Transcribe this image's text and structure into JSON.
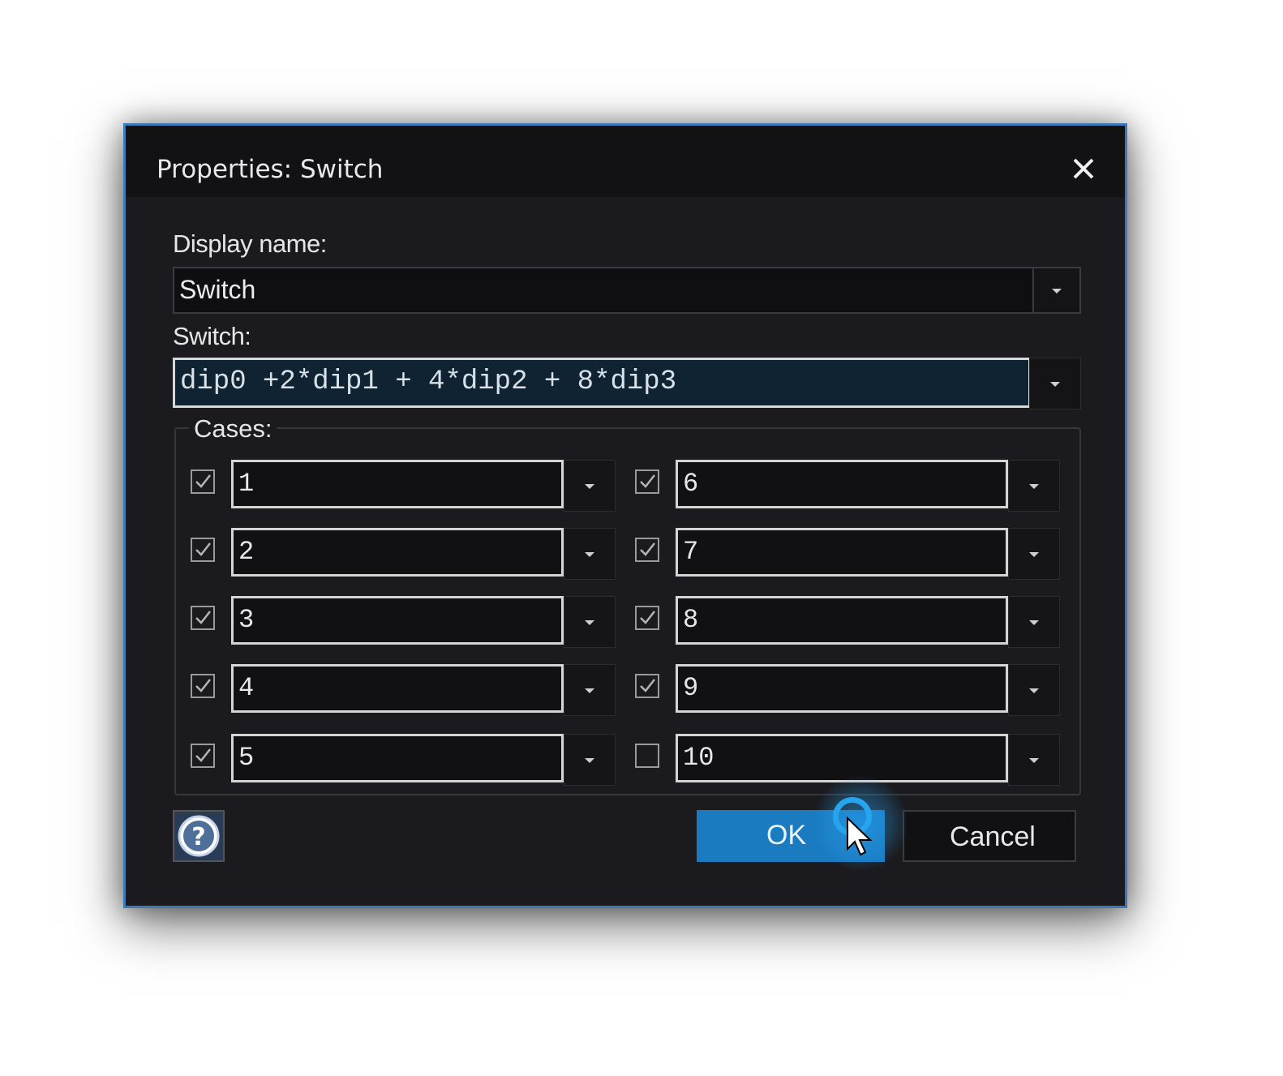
{
  "dialog": {
    "title": "Properties: Switch",
    "display_name_label": "Display name:",
    "display_name_value": "Switch",
    "switch_label": "Switch:",
    "switch_value": "dip0 +2*dip1 + 4*dip2 + 8*dip3",
    "cases_label": "Cases:",
    "cases": [
      {
        "value": "1",
        "checked": true
      },
      {
        "value": "2",
        "checked": true
      },
      {
        "value": "3",
        "checked": true
      },
      {
        "value": "4",
        "checked": true
      },
      {
        "value": "5",
        "checked": true
      },
      {
        "value": "6",
        "checked": true
      },
      {
        "value": "7",
        "checked": true
      },
      {
        "value": "8",
        "checked": true
      },
      {
        "value": "9",
        "checked": true
      },
      {
        "value": "10",
        "checked": false
      }
    ],
    "ok_label": "OK",
    "cancel_label": "Cancel",
    "help_icon": "help-icon",
    "close_icon": "close-icon"
  },
  "colors": {
    "accent": "#1a7bc0",
    "background": "#1b1b1f",
    "border": "#3a7ab8"
  }
}
